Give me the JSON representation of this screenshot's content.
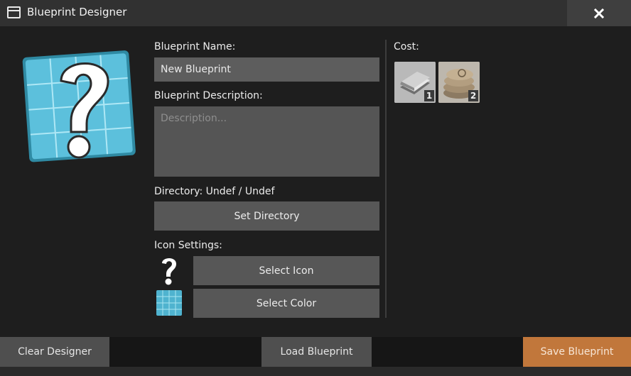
{
  "window": {
    "title": "Blueprint Designer",
    "close_symbol": "close-icon"
  },
  "form": {
    "name_label": "Blueprint Name:",
    "name_value": "New Blueprint",
    "description_label": "Blueprint Description:",
    "description_placeholder": "Description...",
    "directory_label": "Directory: Undef / Undef",
    "set_directory_label": "Set Directory",
    "icon_settings_label": "Icon Settings:",
    "select_icon_label": "Select Icon",
    "select_color_label": "Select Color"
  },
  "cost": {
    "label": "Cost:",
    "items": [
      {
        "icon": "metal-sheets-icon",
        "count": "1"
      },
      {
        "icon": "sandbags-icon",
        "count": "2"
      }
    ]
  },
  "footer": {
    "clear_label": "Clear Designer",
    "load_label": "Load Blueprint",
    "save_label": "Save Blueprint"
  },
  "colors": {
    "accent_save": "#c1773b",
    "blueprint_icon": "#4fb3cf"
  }
}
